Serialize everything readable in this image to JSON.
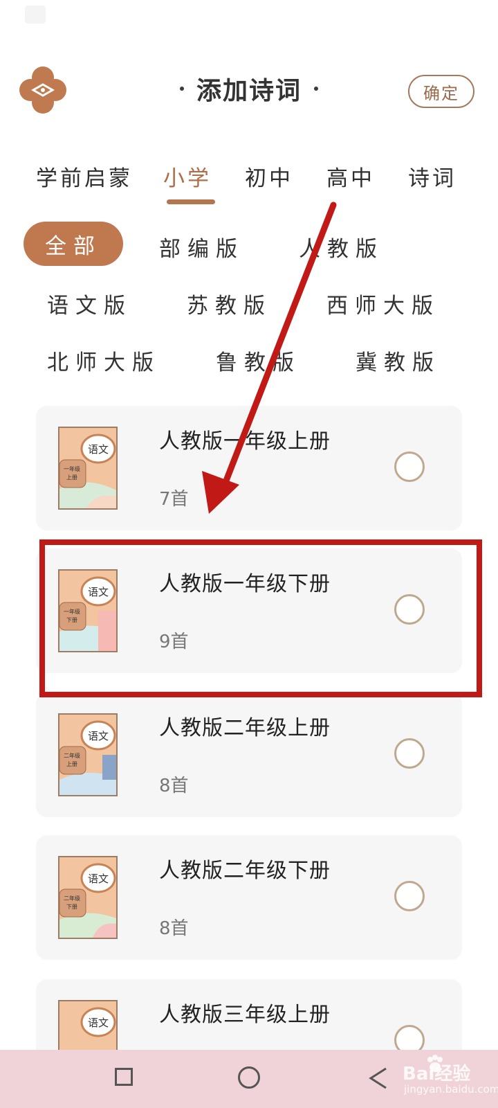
{
  "header": {
    "title": "添加诗词",
    "confirm_label": "确定"
  },
  "level_tabs": [
    {
      "label": "学前启蒙",
      "active": false
    },
    {
      "label": "小学",
      "active": true
    },
    {
      "label": "初中",
      "active": false
    },
    {
      "label": "高中",
      "active": false
    },
    {
      "label": "诗词",
      "active": false
    }
  ],
  "editions": [
    {
      "label": "全部",
      "active": true
    },
    {
      "label": "部编版",
      "active": false
    },
    {
      "label": "人教版",
      "active": false
    },
    {
      "label": "语文版",
      "active": false
    },
    {
      "label": "苏教版",
      "active": false
    },
    {
      "label": "西师大版",
      "active": false
    },
    {
      "label": "北师大版",
      "active": false
    },
    {
      "label": "鲁教版",
      "active": false
    },
    {
      "label": "冀教版",
      "active": false
    }
  ],
  "books": [
    {
      "title": "人教版一年级上册",
      "count": "7首",
      "cover_subject": "语文",
      "cover_grade": "一年级",
      "cover_term": "上册",
      "selected": false
    },
    {
      "title": "人教版一年级下册",
      "count": "9首",
      "cover_subject": "语文",
      "cover_grade": "一年级",
      "cover_term": "下册",
      "selected": false
    },
    {
      "title": "人教版二年级上册",
      "count": "8首",
      "cover_subject": "语文",
      "cover_grade": "二年级",
      "cover_term": "上册",
      "selected": false
    },
    {
      "title": "人教版二年级下册",
      "count": "8首",
      "cover_subject": "语文",
      "cover_grade": "二年级",
      "cover_term": "下册",
      "selected": false
    },
    {
      "title": "人教版三年级上册",
      "count": "",
      "cover_subject": "语文",
      "cover_grade": "",
      "cover_term": "",
      "selected": false
    }
  ],
  "watermark": {
    "text": "Bai经验",
    "url": "jingyan.baidu.com"
  },
  "colors": {
    "accent": "#b4764f",
    "active_pill": "#c0784f",
    "highlight": "#c11a16",
    "nav_bar": "#f0d3d8"
  }
}
